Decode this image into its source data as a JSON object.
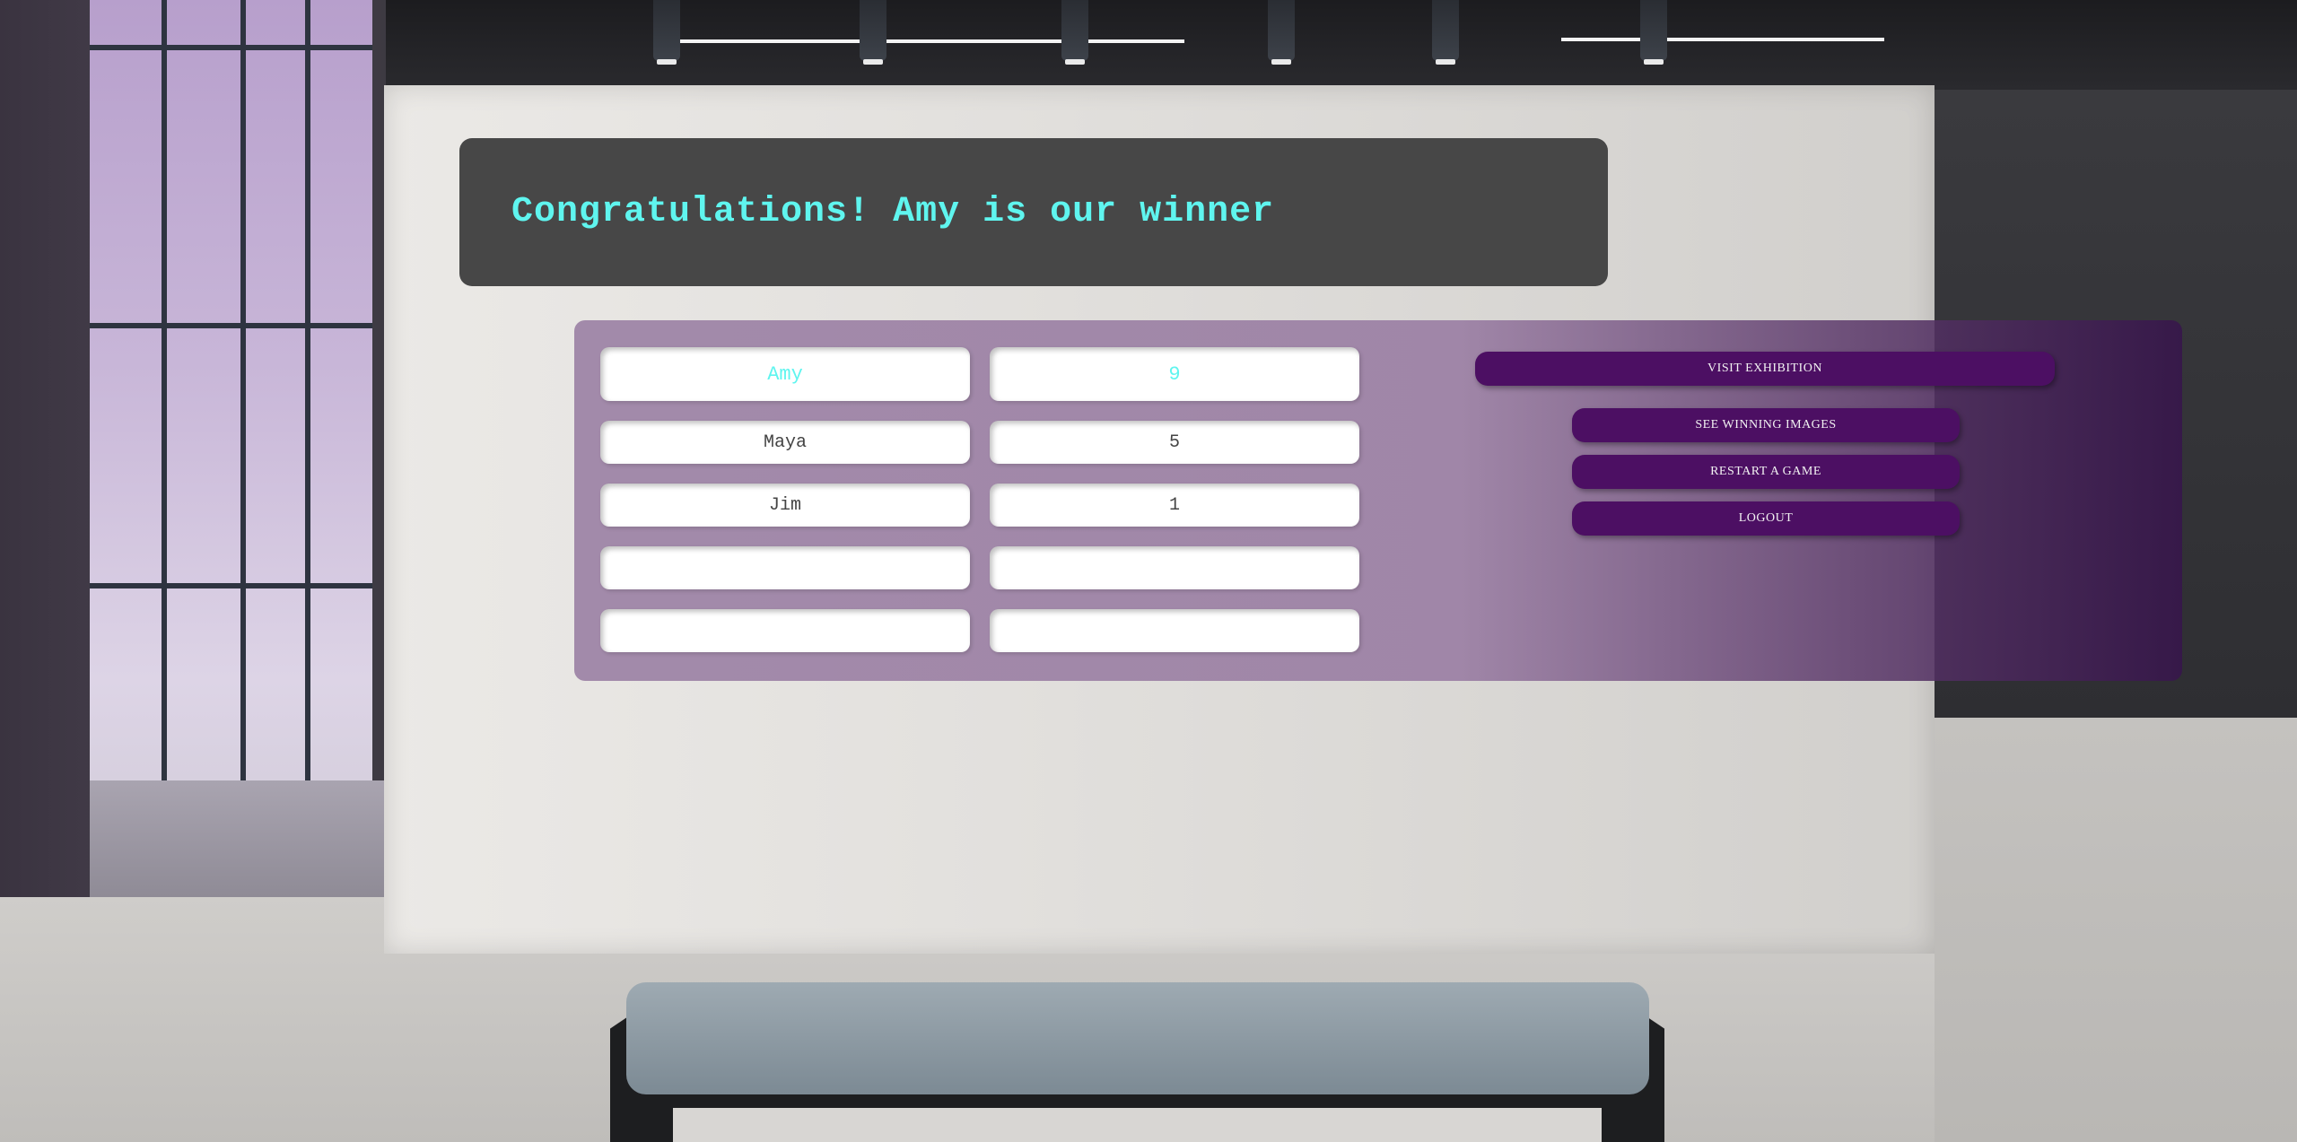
{
  "banner": {
    "message": "Congratulations! Amy is our winner"
  },
  "scoreboard": {
    "rows": [
      {
        "name": "Amy",
        "score": "9",
        "highlight": true
      },
      {
        "name": "Maya",
        "score": "5"
      },
      {
        "name": "Jim",
        "score": "1"
      },
      {
        "name": "",
        "score": ""
      },
      {
        "name": "",
        "score": ""
      }
    ]
  },
  "actions": {
    "visit_exhibition": "VISIT EXHIBITION",
    "see_winning_images": "SEE WINNING IMAGES",
    "restart_game": "RESTART A GAME",
    "logout": "LOGOUT"
  },
  "colors": {
    "accent_text": "#5ff5ef",
    "button_bg": "#4c0f63",
    "banner_bg": "#474747"
  }
}
